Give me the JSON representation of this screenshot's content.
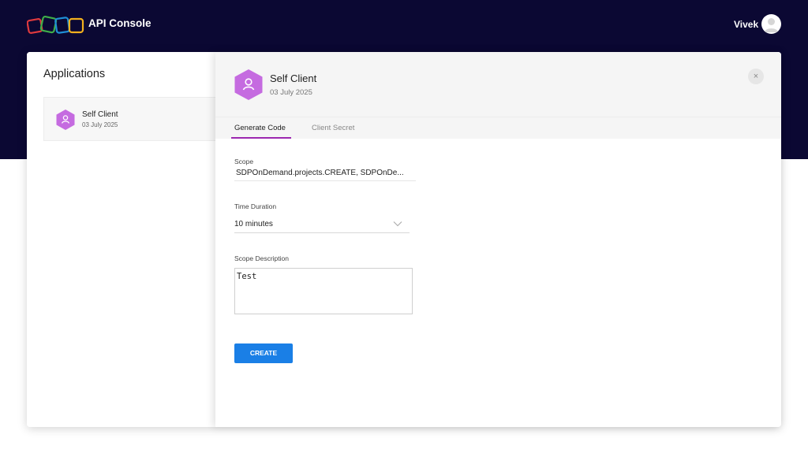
{
  "header": {
    "title": "API Console",
    "user_name": "Vivek"
  },
  "applications": {
    "title": "Applications",
    "items": [
      {
        "name": "Self Client",
        "date": "03 July 2025"
      }
    ]
  },
  "detail": {
    "name": "Self Client",
    "date": "03 July 2025",
    "close_label": "×",
    "tabs": [
      {
        "label": "Generate Code",
        "active": true
      },
      {
        "label": "Client Secret",
        "active": false
      }
    ],
    "form": {
      "scope_label": "Scope",
      "scope_value": "SDPOnDemand.projects.CREATE, SDPOnDe...",
      "duration_label": "Time Duration",
      "duration_value": "10 minutes",
      "description_label": "Scope Description",
      "description_value": "Test",
      "create_label": "CREATE"
    }
  },
  "colors": {
    "header_bg": "#0b0833",
    "accent_purple": "#9c27b0",
    "client_icon": "#c56be0",
    "button_blue": "#1a7fe6"
  },
  "icons": {
    "logo": "zoho-logo",
    "client": "user-hexagon-icon",
    "close": "close-icon",
    "dropdown": "chevron-down-icon"
  }
}
